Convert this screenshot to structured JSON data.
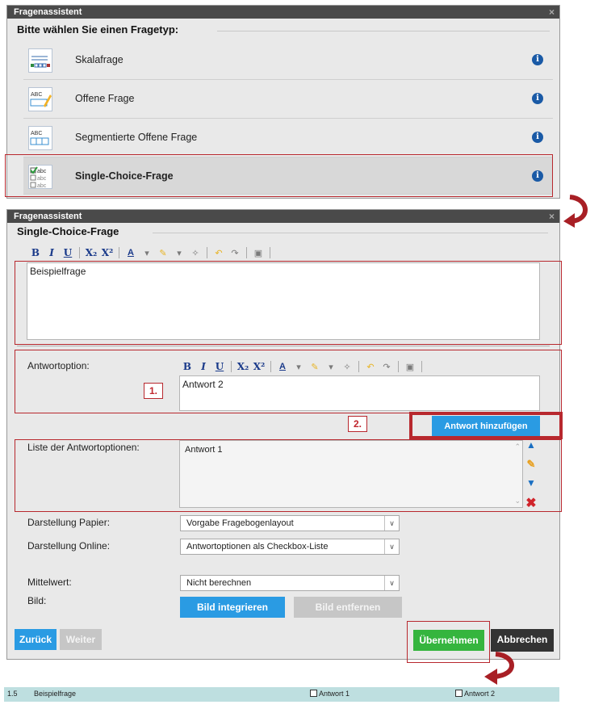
{
  "dialog1": {
    "title": "Fragenassistent",
    "close": "×",
    "group_title": "Bitte wählen Sie einen Fragetyp:",
    "question_types": [
      {
        "label": "Skalafrage",
        "icon": "scale-question-icon"
      },
      {
        "label": "Offene Frage",
        "icon": "open-question-icon"
      },
      {
        "label": "Segmentierte Offene Frage",
        "icon": "segmented-question-icon"
      },
      {
        "label": "Single-Choice-Frage",
        "icon": "single-choice-icon",
        "selected": true
      }
    ],
    "info_glyph": "i"
  },
  "dialog2": {
    "title": "Fragenassistent",
    "close": "×",
    "group_title": "Single-Choice-Frage",
    "question_text": "Beispielfrage",
    "answer_option_label": "Antwortoption:",
    "answer_option_value": "Antwort 2",
    "add_answer_button": "Antwort hinzufügen",
    "answer_list_label": "Liste der Antwortoptionen:",
    "answer_list": [
      "Antwort 1"
    ],
    "paper_label": "Darstellung Papier:",
    "paper_value": "Vorgabe Fragebogenlayout",
    "online_label": "Darstellung Online:",
    "online_value": "Antwortoptionen als Checkbox-Liste",
    "mean_label": "Mittelwert:",
    "mean_value": "Nicht berechnen",
    "image_label": "Bild:",
    "image_insert_button": "Bild integrieren",
    "image_remove_button": "Bild entfernen",
    "back_button": "Zurück",
    "next_button": "Weiter",
    "apply_button": "Übernehmen",
    "cancel_button": "Abbrechen"
  },
  "annotations": {
    "step1": "1.",
    "step2": "2."
  },
  "preview": {
    "number": "1.5",
    "question": "Beispielfrage",
    "options": [
      "Antwort 1",
      "Antwort 2"
    ]
  },
  "colors": {
    "accent_red": "#b8282e",
    "button_blue": "#2a9be3",
    "button_green": "#35b53e",
    "titlebar": "#4a4a4a",
    "preview_bg": "#bedfe0"
  }
}
